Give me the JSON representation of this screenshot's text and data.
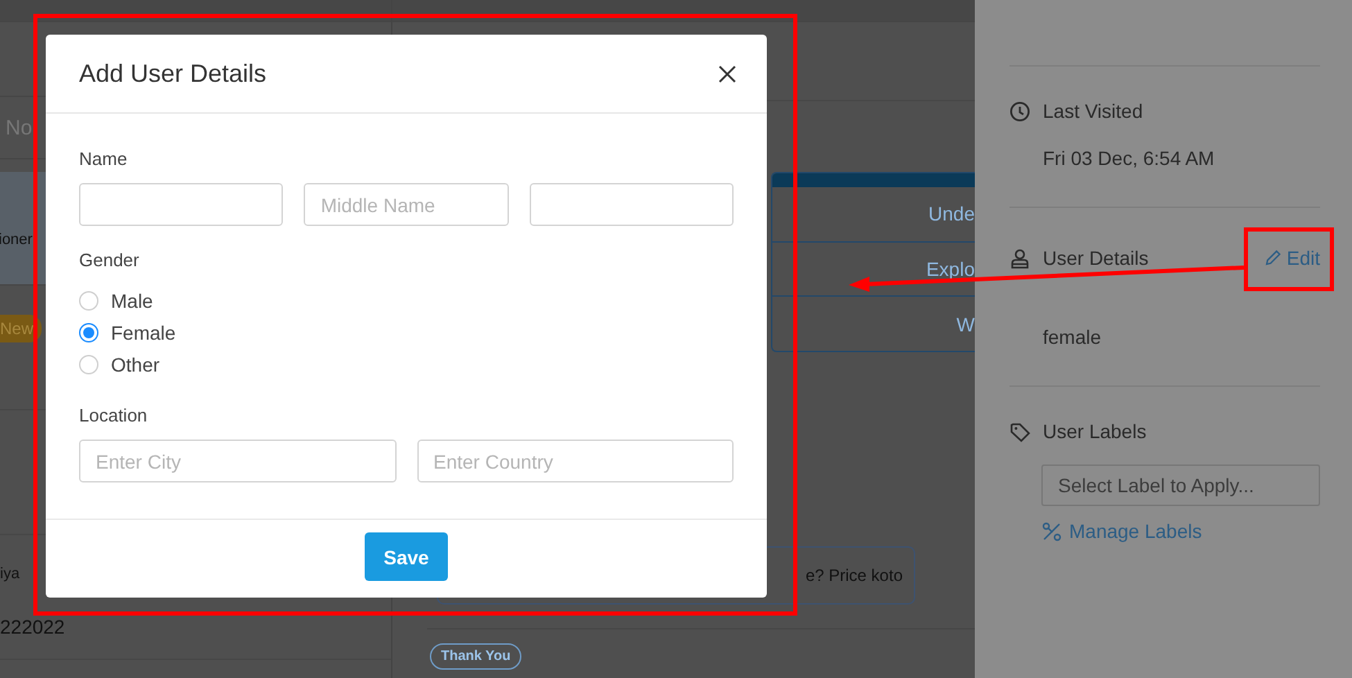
{
  "conversation_list": {
    "filter_text": "No",
    "rows": [
      {
        "kind": "text",
        "text": "ioner",
        "selected": true
      },
      {
        "kind": "badge",
        "text": "New",
        "selected": false
      },
      {
        "kind": "text",
        "text": "iya",
        "subtext": "222022",
        "selected": false
      }
    ]
  },
  "chat": {
    "card_rows": [
      "Unde",
      "Explo",
      "W"
    ],
    "message": "e? Price koto",
    "quick_reply": "Thank You"
  },
  "side_panel": {
    "sections": [
      {
        "kind": "last_visited",
        "title": "Last Visited",
        "value": "Fri 03 Dec, 6:54 AM"
      },
      {
        "kind": "user_details",
        "title": "User Details",
        "action": "Edit",
        "value": "female"
      },
      {
        "kind": "labels",
        "title": "User Labels",
        "placeholder": "Select Label to Apply...",
        "link": "Manage Labels"
      }
    ]
  },
  "modal": {
    "title": "Add User Details",
    "name_label": "Name",
    "name_fields": [
      {
        "kind": "input"
      },
      {
        "kind": "input",
        "placeholder": "Middle Name"
      },
      {
        "kind": "input"
      }
    ],
    "gender": {
      "label": "Gender",
      "options": [
        {
          "label": "Male",
          "selected": false
        },
        {
          "label": "Female",
          "selected": true
        },
        {
          "label": "Other",
          "selected": false
        }
      ]
    },
    "location": {
      "label": "Location",
      "fields": [
        {
          "placeholder": "Enter City"
        },
        {
          "placeholder": "Enter Country"
        }
      ]
    },
    "save": "Save"
  },
  "annotations": [
    {
      "kind": "frame"
    },
    {
      "kind": "frame"
    },
    {
      "kind": "arrow"
    }
  ]
}
